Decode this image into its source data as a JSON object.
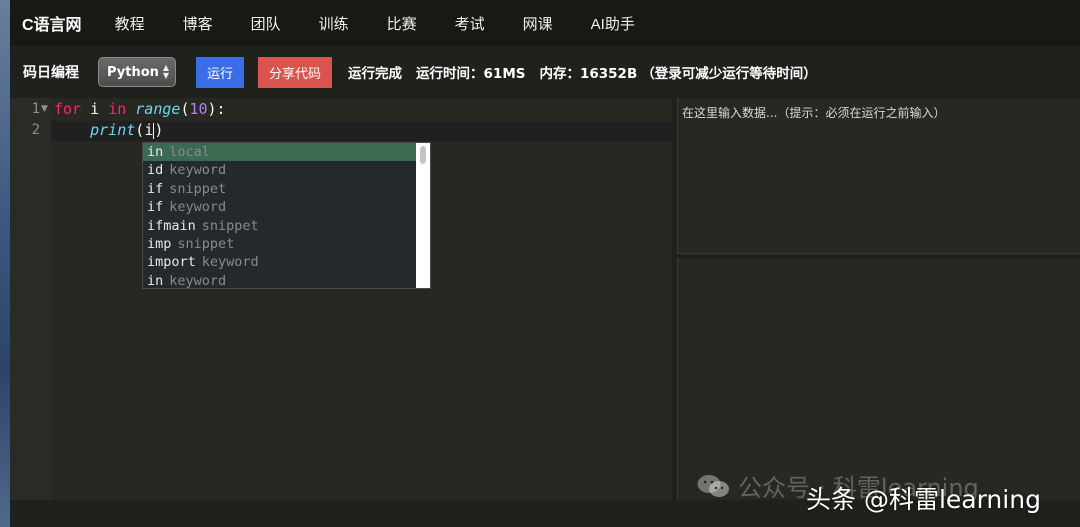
{
  "nav": {
    "brand": "C语言网",
    "items": [
      "教程",
      "博客",
      "团队",
      "训练",
      "比赛",
      "考试",
      "网课",
      "AI助手"
    ]
  },
  "toolbar": {
    "title": "码日编程",
    "language": "Python",
    "run_label": "运行",
    "share_label": "分享代码",
    "status": "运行完成",
    "runtime": "运行时间：61MS",
    "memory": "内存：16352B",
    "note": "（登录可减少运行等待时间）"
  },
  "editor": {
    "line_numbers": [
      "1",
      "2"
    ],
    "line1": {
      "kw1": "for",
      "var": " i ",
      "kw2": "in",
      "fn": " range",
      "open": "(",
      "num": "10",
      "close": "):"
    },
    "line2": {
      "indent": "    ",
      "fn": "print",
      "open": "(",
      "arg": "i",
      "close": ")"
    }
  },
  "autocomplete": {
    "items": [
      {
        "word": "in",
        "meta": "local"
      },
      {
        "word": "id",
        "meta": "keyword"
      },
      {
        "word": "if",
        "meta": "snippet"
      },
      {
        "word": "if",
        "meta": "keyword"
      },
      {
        "word": "ifmain",
        "meta": "snippet"
      },
      {
        "word": "imp",
        "meta": "snippet"
      },
      {
        "word": "import",
        "meta": "keyword"
      },
      {
        "word": "in",
        "meta": "keyword"
      }
    ]
  },
  "input_panel": {
    "placeholder": "在这里输入数据...（提示：必须在运行之前输入）"
  },
  "watermark": {
    "line1": "公众号 · 科雷learning",
    "line2": "头条 @科雷learning"
  },
  "colors": {
    "keyword": "#f92672",
    "function": "#66d9ef",
    "number": "#ae81ff",
    "run_button": "#3b6ee6",
    "share_button": "#d9534f",
    "selected_suggestion": "#3a6b52"
  }
}
